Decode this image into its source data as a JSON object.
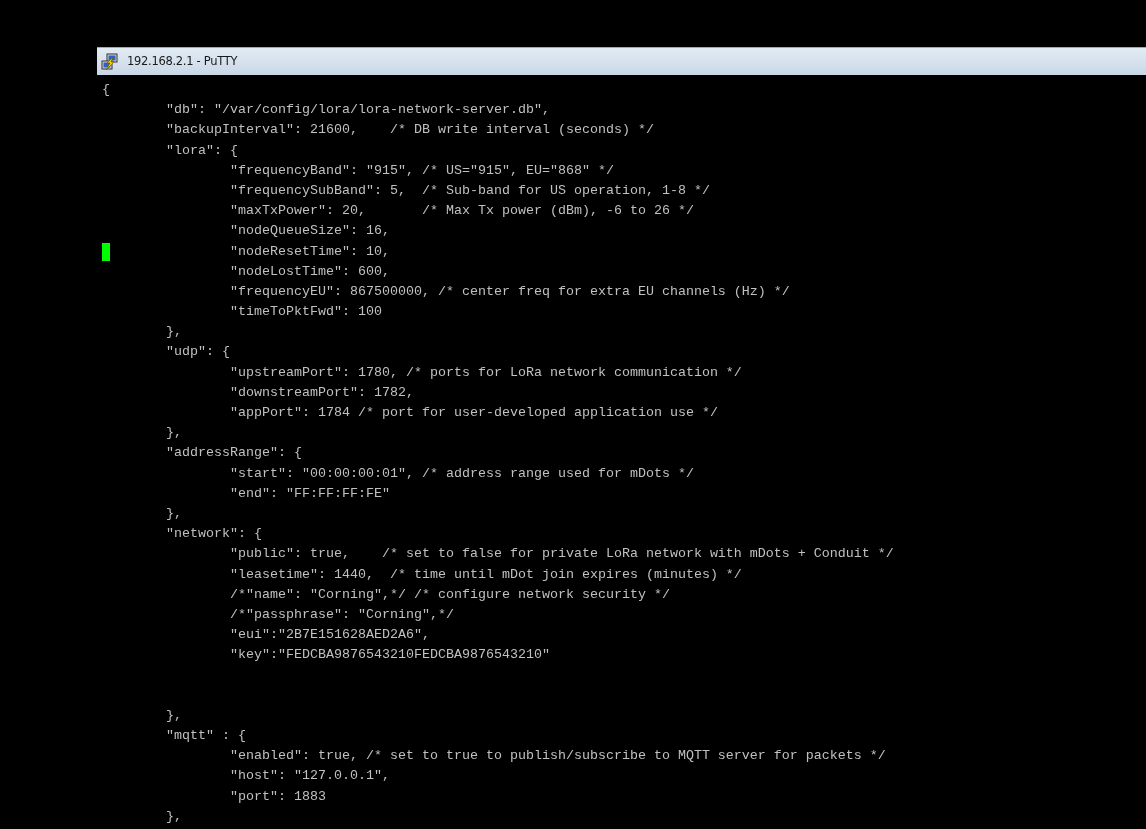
{
  "window": {
    "title": "192.168.2.1 - PuTTY"
  },
  "terminal": {
    "lines": [
      {
        "text": "{",
        "cursor": false
      },
      {
        "text": "\t\"db\": \"/var/config/lora/lora-network-server.db\",",
        "cursor": false
      },
      {
        "text": "\t\"backupInterval\": 21600,    /* DB write interval (seconds) */",
        "cursor": false
      },
      {
        "text": "\t\"lora\": {",
        "cursor": false
      },
      {
        "text": "\t\t\"frequencyBand\": \"915\", /* US=\"915\", EU=\"868\" */",
        "cursor": false
      },
      {
        "text": "\t\t\"frequencySubBand\": 5,  /* Sub-band for US operation, 1-8 */",
        "cursor": false
      },
      {
        "text": "\t\t\"maxTxPower\": 20,       /* Max Tx power (dBm), -6 to 26 */",
        "cursor": false
      },
      {
        "text": "\t\t\"nodeQueueSize\": 16,",
        "cursor": false
      },
      {
        "text": "\t\t\"nodeResetTime\": 10,",
        "cursor": true
      },
      {
        "text": "\t\t\"nodeLostTime\": 600,",
        "cursor": false
      },
      {
        "text": "\t\t\"frequencyEU\": 867500000, /* center freq for extra EU channels (Hz) */",
        "cursor": false
      },
      {
        "text": "\t\t\"timeToPktFwd\": 100",
        "cursor": false
      },
      {
        "text": "\t},",
        "cursor": false
      },
      {
        "text": "\t\"udp\": {",
        "cursor": false
      },
      {
        "text": "\t\t\"upstreamPort\": 1780, /* ports for LoRa network communication */",
        "cursor": false
      },
      {
        "text": "\t\t\"downstreamPort\": 1782,",
        "cursor": false
      },
      {
        "text": "\t\t\"appPort\": 1784 /* port for user-developed application use */",
        "cursor": false
      },
      {
        "text": "\t},",
        "cursor": false
      },
      {
        "text": "\t\"addressRange\": {",
        "cursor": false
      },
      {
        "text": "\t\t\"start\": \"00:00:00:01\", /* address range used for mDots */",
        "cursor": false
      },
      {
        "text": "\t\t\"end\": \"FF:FF:FF:FE\"",
        "cursor": false
      },
      {
        "text": "\t},",
        "cursor": false
      },
      {
        "text": "\t\"network\": {",
        "cursor": false
      },
      {
        "text": "\t\t\"public\": true,    /* set to false for private LoRa network with mDots + Conduit */",
        "cursor": false
      },
      {
        "text": "\t\t\"leasetime\": 1440,  /* time until mDot join expires (minutes) */",
        "cursor": false
      },
      {
        "text": "\t\t/*\"name\": \"Corning\",*/ /* configure network security */",
        "cursor": false
      },
      {
        "text": "\t\t/*\"passphrase\": \"Corning\",*/",
        "cursor": false
      },
      {
        "text": "\t\t\"eui\":\"2B7E151628AED2A6\",",
        "cursor": false
      },
      {
        "text": "\t\t\"key\":\"FEDCBA9876543210FEDCBA9876543210\"",
        "cursor": false
      },
      {
        "text": "\n\n\t},",
        "cursor": false
      },
      {
        "text": "\t\"mqtt\" : {",
        "cursor": false
      },
      {
        "text": "\t\t\"enabled\": true, /* set to true to publish/subscribe to MQTT server for packets */",
        "cursor": false
      },
      {
        "text": "\t\t\"host\": \"127.0.0.1\",",
        "cursor": false
      },
      {
        "text": "\t\t\"port\": 1883",
        "cursor": false
      },
      {
        "text": "\t},",
        "cursor": false
      }
    ]
  }
}
